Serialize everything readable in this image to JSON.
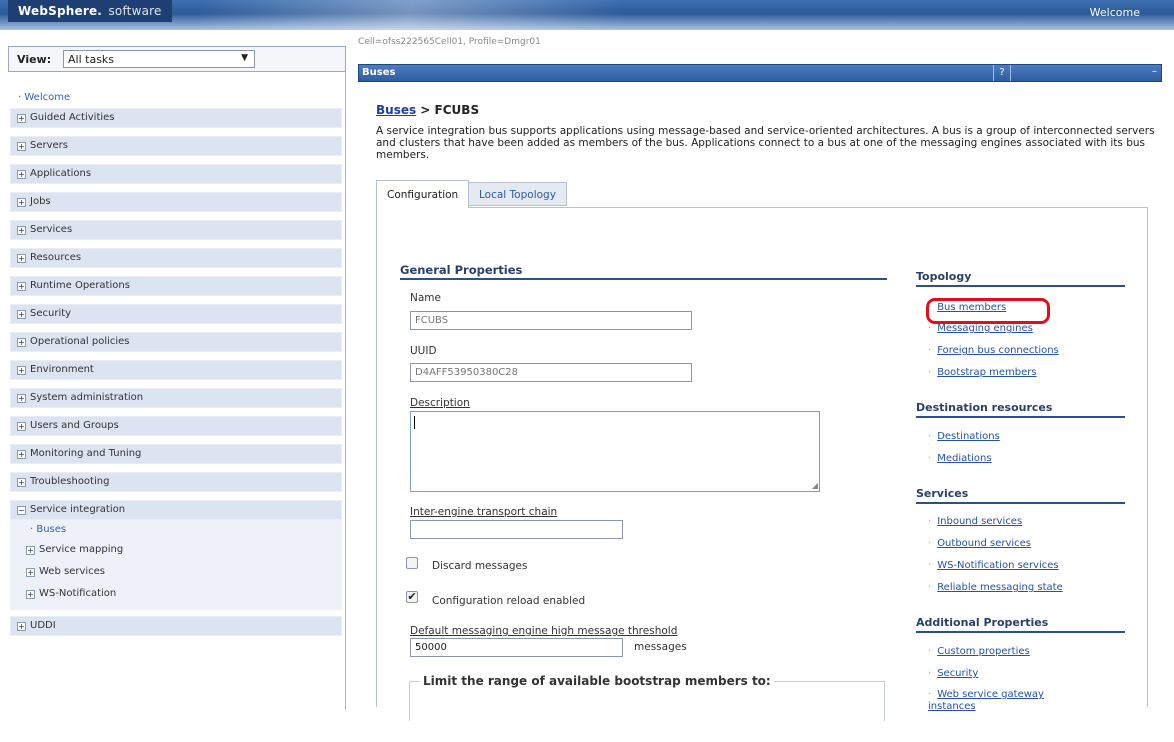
{
  "banner": {
    "brand": "WebSphere.",
    "brand_suffix": "software",
    "welcome": "Welcome"
  },
  "nav": {
    "view_label": "View:",
    "view_select": "All tasks",
    "welcome_link": "Welcome",
    "items": [
      "Guided Activities",
      "Servers",
      "Applications",
      "Jobs",
      "Services",
      "Resources",
      "Runtime Operations",
      "Security",
      "Operational policies",
      "Environment",
      "System administration",
      "Users and Groups",
      "Monitoring and Tuning",
      "Troubleshooting",
      "Service integration",
      "UDDI"
    ],
    "sub_items": {
      "buses": "Buses",
      "service_mapping": "Service mapping",
      "web_services": "Web services",
      "ws_notification": "WS-Notification"
    }
  },
  "main": {
    "cell_info": "Cell=ofss222565Cell01, Profile=Dmgr01",
    "panel_title": "Buses",
    "help": "?",
    "minimize": "–",
    "breadcrumb_link": "Buses",
    "breadcrumb_sep": " > ",
    "breadcrumb_current": "FCUBS",
    "intro": "A service integration bus supports applications using message-based and service-oriented architectures. A bus is a group of interconnected servers and clusters that have been added as members of the bus. Applications connect to a bus at one of the messaging engines associated with its bus members.",
    "tabs": {
      "configuration": "Configuration",
      "local_topology": "Local Topology"
    },
    "general_properties": "General Properties",
    "name_label": "Name",
    "name_value": "FCUBS",
    "uuid_label": "UUID",
    "uuid_value": "D4AFF53950380C28",
    "description_label": "Description",
    "transport_label": "Inter-engine transport chain",
    "transport_value": "",
    "discard_label": "Discard messages",
    "discard_checked": false,
    "reload_label": "Configuration reload enabled",
    "reload_checked": true,
    "threshold_label": "Default messaging engine high message threshold",
    "threshold_value": "50000",
    "threshold_unit": "messages",
    "bootstrap_legend": "Limit the range of available bootstrap members to:"
  },
  "right": {
    "topology": {
      "title": "Topology",
      "links": [
        "Bus members",
        "Messaging engines",
        "Foreign bus connections",
        "Bootstrap members"
      ]
    },
    "destination": {
      "title": "Destination resources",
      "links": [
        "Destinations",
        "Mediations"
      ]
    },
    "services": {
      "title": "Services",
      "links": [
        "Inbound services",
        "Outbound services",
        "WS-Notification services",
        "Reliable messaging state"
      ]
    },
    "additional": {
      "title": "Additional Properties",
      "links": [
        "Custom properties",
        "Security",
        "Web service gateway instances"
      ]
    }
  },
  "colors": {
    "banner": "#2c5a99",
    "nav_item": "#dde4f1",
    "link": "#2552a8",
    "highlight": "#e0101a"
  }
}
